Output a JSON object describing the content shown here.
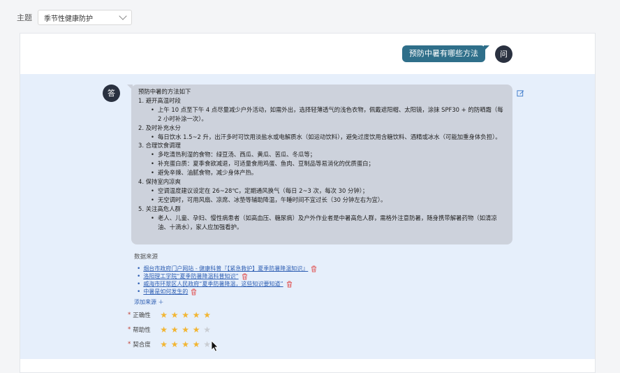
{
  "topic": {
    "label": "主题",
    "value": "季节性健康防护"
  },
  "question": {
    "avatar": "问",
    "text": "预防中暑有哪些方法"
  },
  "answer": {
    "avatar": "答",
    "intro": "预防中暑的方法如下",
    "sections": [
      {
        "title": "1. 避开高温时段",
        "bullets": [
          "上午 10 点至下午 4 点尽量减少户外活动，如需外出，选择轻薄透气的浅色衣物，佩戴遮阳帽、太阳镜，涂抹 SPF30 + 的防晒霜（每 2 小时补涂一次）。"
        ]
      },
      {
        "title": "2. 及时补充水分",
        "bullets": [
          "每日饮水 1.5~2 升，出汗多时可饮用淡盐水或电解质水（如运动饮料），避免过度饮用含糖饮料、酒精或冰水（可能加重身体负担）。"
        ]
      },
      {
        "title": "3. 合理饮食调理",
        "bullets": [
          "多吃清热利湿的食物：绿豆汤、西瓜、黄瓜、苦瓜、冬瓜等；",
          "补充蛋白质：夏季食欲减退，可适量食用鸡蛋、鱼肉、豆制品等易消化的优质蛋白；",
          "避免辛辣、油腻食物，减少身体产热。"
        ]
      },
      {
        "title": "4. 保持室内凉爽",
        "bullets": [
          "空调温度建议设定在 26~28℃，定期通风换气（每日 2~3 次，每次 30 分钟）；",
          "无空调时，可用风扇、凉席、冰垫等辅助降温，午睡时间不宜过长（30 分钟左右为宜）。"
        ]
      },
      {
        "title": "5. 关注高危人群",
        "bullets": [
          "老人、儿童、孕妇、慢性病患者（如高血压、糖尿病）及户外作业者是中暑高危人群，需格外注意防暑，随身携带解暑药物（如清凉油、十滴水），家人应加强看护。"
        ]
      }
    ]
  },
  "sources": {
    "title": "数据来源",
    "items": [
      "烟台市政府门户网站 - 健康科普『【紧急救护】夏季防暑降温知识』",
      "洛阳理工学院“夏季防暑降温科普知识”",
      "威海市环翠区人民政府“夏季防暑降温，这些知识要知道”",
      "中暑是如何发生的"
    ],
    "add_label": "添加来源 ＋"
  },
  "ratings": [
    {
      "label": "正确性",
      "value": 5,
      "max": 5
    },
    {
      "label": "帮助性",
      "value": 4,
      "max": 5
    },
    {
      "label": "契合度",
      "value": 4,
      "max": 5
    }
  ],
  "colors": {
    "question_bubble": "#2f6f8a",
    "answer_bg": "#e6effb",
    "answer_bubble": "#cdd2dc",
    "star_on": "#f2b532",
    "link": "#2f5fb3"
  }
}
